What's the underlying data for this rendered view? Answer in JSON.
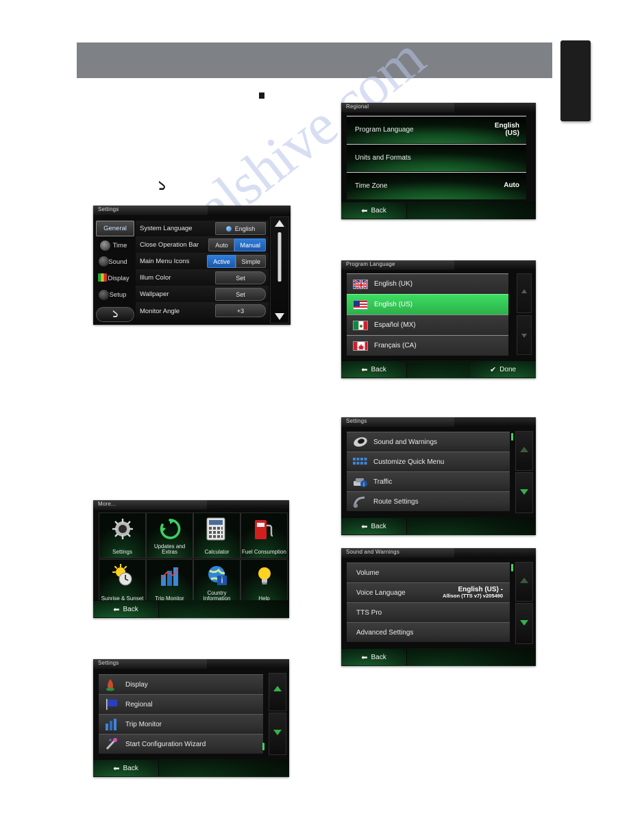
{
  "page": {
    "header_band": "",
    "bullet": "",
    "back_glyph": "↰",
    "watermark": "ualshive.com"
  },
  "screens": {
    "head_unit_settings": {
      "title": "Settings",
      "tabs": [
        {
          "label": "General",
          "icon": "general-tab-icon",
          "selected": true
        },
        {
          "label": "Time",
          "icon": "clock-tab-icon",
          "selected": false
        },
        {
          "label": "Sound",
          "icon": "sound-tab-icon",
          "selected": false
        },
        {
          "label": "Display",
          "icon": "display-tab-icon",
          "selected": false
        },
        {
          "label": "Setup",
          "icon": "setup-tab-icon",
          "selected": false
        }
      ],
      "back_icon": "back-arrow-icon",
      "rows": [
        {
          "label": "System Language",
          "control": "radio",
          "value": "English"
        },
        {
          "label": "Close Operation Bar",
          "control": "toggle",
          "options": [
            "Auto",
            "Manual"
          ],
          "selected": "Manual"
        },
        {
          "label": "Main Menu Icons",
          "control": "toggle",
          "options": [
            "Active",
            "Simple"
          ],
          "selected": "Active"
        },
        {
          "label": "Illum Color",
          "control": "set",
          "value": "Set"
        },
        {
          "label": "Wallpaper",
          "control": "set",
          "value": "Set"
        },
        {
          "label": "Monitor Angle",
          "control": "set",
          "value": "+3"
        }
      ],
      "scroll_up": "scroll-up-icon",
      "scroll_down": "scroll-down-icon"
    },
    "more_menu": {
      "title": "More...",
      "tiles": [
        {
          "label": "Settings",
          "icon": "gear-icon"
        },
        {
          "label": "Updates and Extras",
          "icon": "refresh-arrows-icon"
        },
        {
          "label": "Calculator",
          "icon": "calculator-icon"
        },
        {
          "label": "Fuel Consumption",
          "icon": "fuel-pump-icon"
        },
        {
          "label": "Sunrise & Sunset",
          "icon": "sun-clock-icon"
        },
        {
          "label": "Trip Monitor",
          "icon": "bar-chart-icon"
        },
        {
          "label": "Country Information",
          "icon": "globe-info-icon"
        },
        {
          "label": "Help",
          "icon": "lightbulb-icon"
        }
      ],
      "back_label": "Back"
    },
    "nav_settings_left": {
      "title": "Settings",
      "rows": [
        {
          "label": "Display",
          "icon": "display-icon"
        },
        {
          "label": "Regional",
          "icon": "flag-icon"
        },
        {
          "label": "Trip Monitor",
          "icon": "bar-chart-icon"
        },
        {
          "label": "Start Configuration Wizard",
          "icon": "magic-wand-icon"
        }
      ],
      "back_label": "Back",
      "scroll_up": "scroll-up-icon",
      "scroll_down": "scroll-down-icon"
    },
    "regional": {
      "title": "Regional",
      "rows": [
        {
          "label": "Program Language",
          "value": "English\n(US)"
        },
        {
          "label": "Units and Formats",
          "value": ""
        },
        {
          "label": "Time Zone",
          "value": "Auto"
        }
      ],
      "back_label": "Back"
    },
    "program_language": {
      "title": "Program Language",
      "items": [
        {
          "label": "English (UK)",
          "flag": "flag-uk",
          "selected": false
        },
        {
          "label": "English (US)",
          "flag": "flag-us",
          "selected": true
        },
        {
          "label": "Español (MX)",
          "flag": "flag-mx",
          "selected": false
        },
        {
          "label": "Français (CA)",
          "flag": "flag-ca",
          "selected": false
        }
      ],
      "back_label": "Back",
      "done_label": "Done"
    },
    "nav_settings_right": {
      "title": "Settings",
      "rows": [
        {
          "label": "Sound and Warnings",
          "icon": "speaker-icon"
        },
        {
          "label": "Customize Quick Menu",
          "icon": "grid-icon"
        },
        {
          "label": "Traffic",
          "icon": "traffic-info-icon"
        },
        {
          "label": "Route Settings",
          "icon": "route-icon"
        }
      ],
      "back_label": "Back",
      "scroll_up": "scroll-up-icon",
      "scroll_down": "scroll-down-icon"
    },
    "sound_and_warnings": {
      "title": "Sound and Warnings",
      "rows": [
        {
          "label": "Volume",
          "value": ""
        },
        {
          "label": "Voice Language",
          "value": "English (US) -",
          "value2": "Allison (TTS v7) v205490"
        },
        {
          "label": "TTS Pro",
          "value": ""
        },
        {
          "label": "Advanced Settings",
          "value": ""
        }
      ],
      "back_label": "Back",
      "scroll_up": "scroll-up-icon",
      "scroll_down": "scroll-down-icon"
    }
  },
  "colors": {
    "header_gray": "#7e8286",
    "accent_green": "#36b24a",
    "select_green": "#3ddc61",
    "accent_blue": "#2f7ddb",
    "screen_black": "#0c0c0c"
  }
}
